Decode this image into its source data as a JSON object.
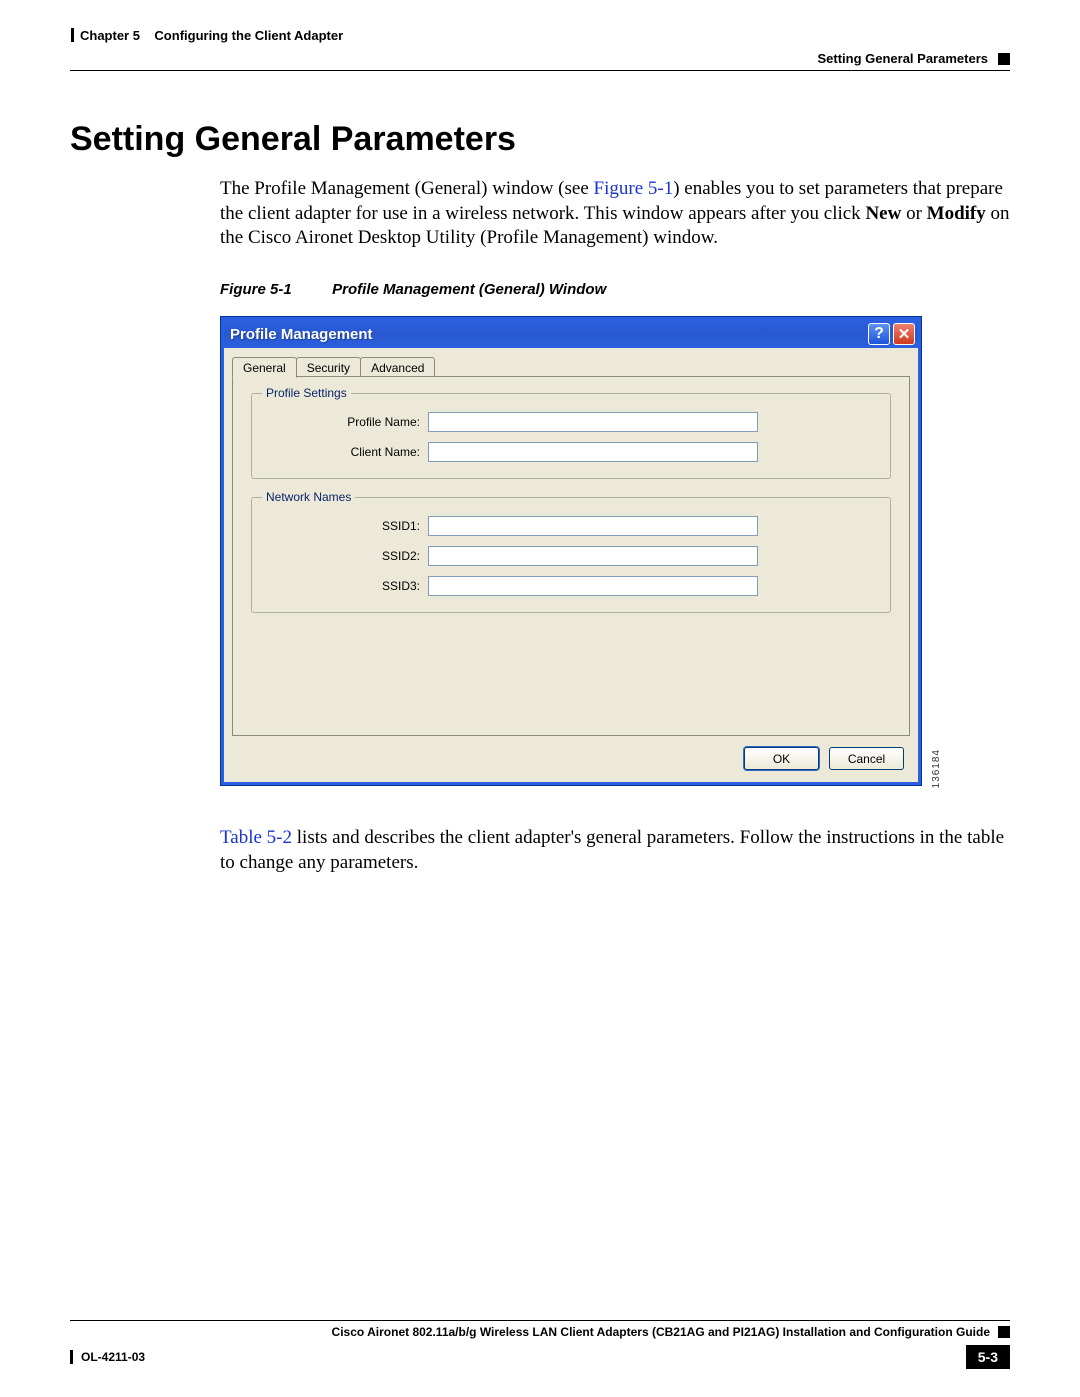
{
  "header": {
    "chapter_label": "Chapter 5",
    "chapter_title": "Configuring the Client Adapter",
    "section_title": "Setting General Parameters"
  },
  "main": {
    "heading": "Setting General Parameters",
    "intro_text_pre": "The Profile Management (General) window (see ",
    "figure_link": "Figure 5-1",
    "intro_text_post_a": ") enables you to set parameters that prepare the client adapter for use in a wireless network. This window appears after you click ",
    "bold_new": "New",
    "intro_or": " or ",
    "bold_modify": "Modify",
    "intro_text_post_b": " on the Cisco Aironet Desktop Utility (Profile Management) window.",
    "figure_caption_num": "Figure 5-1",
    "figure_caption_text": "Profile Management (General) Window",
    "table_link": "Table 5-2",
    "para2_post": " lists and describes the client adapter's general parameters. Follow the instructions in the table to change any parameters."
  },
  "screenshot": {
    "window_title": "Profile Management",
    "tabs": [
      "General",
      "Security",
      "Advanced"
    ],
    "groups": {
      "profile_settings": {
        "legend": "Profile Settings",
        "fields": [
          {
            "label": "Profile Name:",
            "value": ""
          },
          {
            "label": "Client Name:",
            "value": ""
          }
        ]
      },
      "network_names": {
        "legend": "Network Names",
        "fields": [
          {
            "label": "SSID1:",
            "value": ""
          },
          {
            "label": "SSID2:",
            "value": ""
          },
          {
            "label": "SSID3:",
            "value": ""
          }
        ]
      }
    },
    "buttons": {
      "ok": "OK",
      "cancel": "Cancel"
    },
    "image_id": "136184"
  },
  "footer": {
    "guide_title": "Cisco Aironet 802.11a/b/g Wireless LAN Client Adapters (CB21AG and PI21AG) Installation and Configuration Guide",
    "doc_id": "OL-4211-03",
    "page_number": "5-3"
  }
}
